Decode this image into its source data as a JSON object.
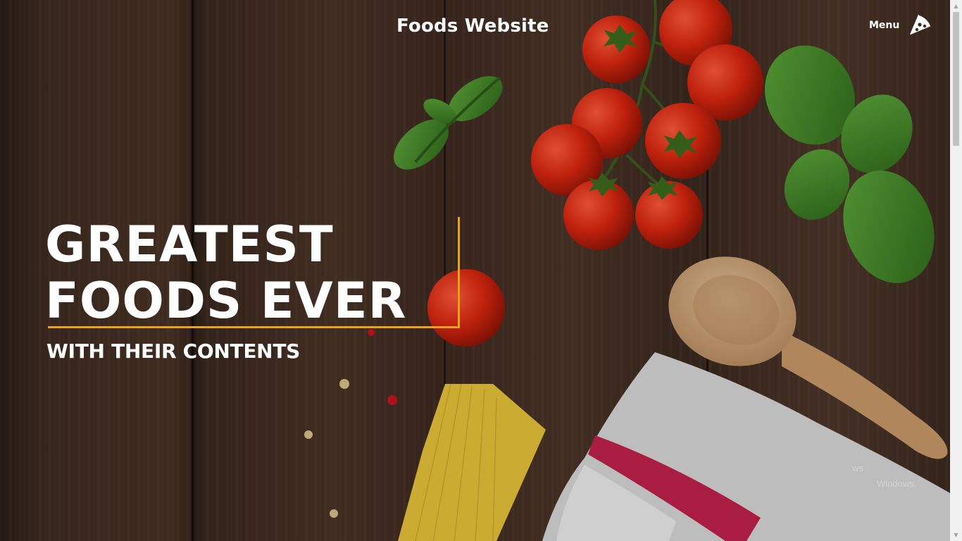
{
  "header": {
    "title": "Foods Website",
    "menu_label": "Menu",
    "menu_icon": "pizza-slice-icon"
  },
  "hero": {
    "line1": "GREATEST",
    "line2": "FOODS EVER",
    "subtitle": "WITH THEIR CONTENTS"
  },
  "colors": {
    "accent": "#e8a317",
    "text": "#ffffff",
    "wood": "#4a3326"
  },
  "watermark": {
    "line1": "ws",
    "line2": "Windows."
  }
}
